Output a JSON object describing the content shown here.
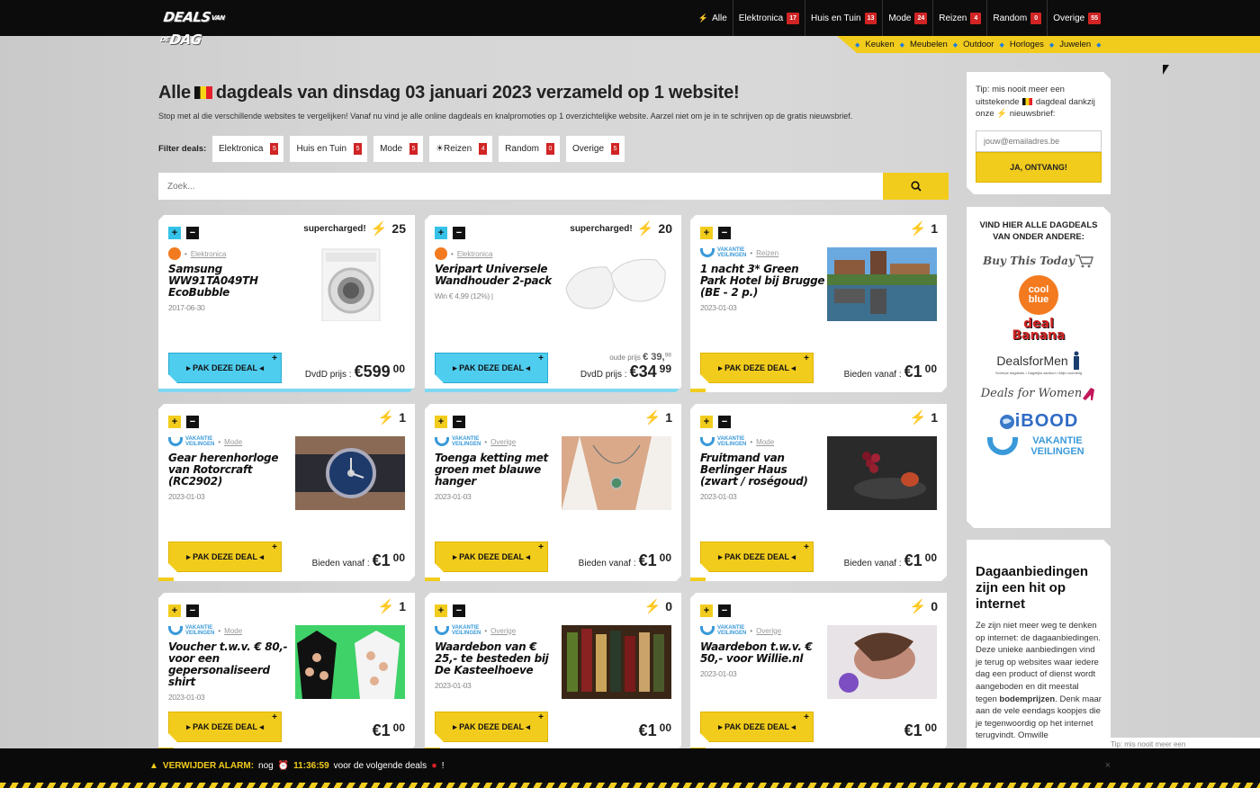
{
  "header": {
    "logo": {
      "part1": "DEALS",
      "small": "VAN DE",
      "part2": "DAG"
    },
    "nav": [
      {
        "label": "Alle",
        "badge": null,
        "icon": "bolt-icon"
      },
      {
        "label": "Elektronica",
        "badge": "17"
      },
      {
        "label": "Huis en Tuin",
        "badge": "13"
      },
      {
        "label": "Mode",
        "badge": "24"
      },
      {
        "label": "Reizen",
        "badge": "4"
      },
      {
        "label": "Random",
        "badge": "0"
      },
      {
        "label": "Overige",
        "badge": "55"
      }
    ],
    "subnav": [
      "Keuken",
      "Meubelen",
      "Outdoor",
      "Horloges",
      "Juwelen"
    ]
  },
  "main": {
    "title_pre": "Alle",
    "title_post": "dagdeals van dinsdag 03 januari 2023 verzameld op 1 website!",
    "intro": "Stop met al die verschillende websites te vergelijken! Vanaf nu vind je alle online dagdeals en knalpromoties op 1 overzichtelijke website. Aarzel niet om je in te schrijven op de gratis nieuwsbrief.",
    "filter_label": "Filter deals:",
    "filters": [
      {
        "label": "Elektronica",
        "badge": "5"
      },
      {
        "label": "Huis en Tuin",
        "badge": "5"
      },
      {
        "label": "Mode",
        "badge": "5"
      },
      {
        "label": "☀Reizen",
        "badge": "4"
      },
      {
        "label": "Random",
        "badge": "0"
      },
      {
        "label": "Overige",
        "badge": "5"
      }
    ],
    "search_placeholder": "Zoek..."
  },
  "deals": [
    {
      "supercharged": "supercharged!",
      "count": "25",
      "source": "coolblue",
      "category": "Elektronica",
      "title": "Samsung WW91TA049TH EcoBubble",
      "meta": "2017-06-30",
      "button": "▸ PAK DEZE DEAL ◂",
      "price_label": "DvdD prijs :",
      "price_main": "€599",
      "price_cents": "00",
      "old_label": "",
      "old_price": "",
      "progress": 1.0,
      "style": "blue"
    },
    {
      "supercharged": "supercharged!",
      "count": "20",
      "source": "coolblue",
      "category": "Elektronica",
      "title": "Veripart Universele Wandhouder 2-pack",
      "meta": "Win € 4,99 (12%) |",
      "button": "▸ PAK DEZE DEAL ◂",
      "price_label": "DvdD prijs :",
      "price_main": "€34",
      "price_cents": "99",
      "old_label": "oude prijs",
      "old_price": "€ 39,",
      "old_cents": "98",
      "progress": 1.0,
      "style": "blue"
    },
    {
      "supercharged": "",
      "count": "1",
      "source": "vakantieveilingen",
      "category": "Reizen",
      "title": "1 nacht 3* Green Park Hotel bij Brugge (BE - 2 p.)",
      "meta": "2023-01-03",
      "button": "▸ PAK DEZE DEAL ◂",
      "price_label": "Bieden vanaf :",
      "price_main": "€1",
      "price_cents": "00",
      "progress": 0.06,
      "style": "yellow"
    },
    {
      "supercharged": "",
      "count": "1",
      "source": "vakantieveilingen",
      "category": "Mode",
      "title": "Gear herenhorloge van Rotorcraft (RC2902)",
      "meta": "2023-01-03",
      "button": "▸ PAK DEZE DEAL ◂",
      "price_label": "Bieden vanaf :",
      "price_main": "€1",
      "price_cents": "00",
      "progress": 0.06,
      "style": "yellow"
    },
    {
      "supercharged": "",
      "count": "1",
      "source": "vakantieveilingen",
      "category": "Overige",
      "title": "Toenga ketting met groen met blauwe hanger",
      "meta": "2023-01-03",
      "button": "▸ PAK DEZE DEAL ◂",
      "price_label": "Bieden vanaf :",
      "price_main": "€1",
      "price_cents": "00",
      "progress": 0.06,
      "style": "yellow"
    },
    {
      "supercharged": "",
      "count": "1",
      "source": "vakantieveilingen",
      "category": "Mode",
      "title": "Fruitmand van Berlinger Haus (zwart / roségoud)",
      "meta": "2023-01-03",
      "button": "▸ PAK DEZE DEAL ◂",
      "price_label": "Bieden vanaf :",
      "price_main": "€1",
      "price_cents": "00",
      "progress": 0.06,
      "style": "yellow"
    },
    {
      "supercharged": "",
      "count": "1",
      "source": "vakantieveilingen",
      "category": "Mode",
      "title": "Voucher t.w.v. € 80,- voor een gepersonaliseerd shirt",
      "meta": "2023-01-03",
      "button": "▸ PAK DEZE DEAL ◂",
      "price_label": "",
      "price_main": "€1",
      "price_cents": "00",
      "progress": 0.06,
      "style": "yellow"
    },
    {
      "supercharged": "",
      "count": "0",
      "source": "vakantieveilingen",
      "category": "Overige",
      "title": "Waardebon van € 25,- te besteden bij De Kasteelhoeve",
      "meta": "2023-01-03",
      "button": "▸ PAK DEZE DEAL ◂",
      "price_label": "",
      "price_main": "€1",
      "price_cents": "00",
      "progress": 0.06,
      "style": "yellow"
    },
    {
      "supercharged": "",
      "count": "0",
      "source": "vakantieveilingen",
      "category": "Overige",
      "title": "Waardebon t.w.v. € 50,- voor Willie.nl",
      "meta": "2023-01-03",
      "button": "▸ PAK DEZE DEAL ◂",
      "price_label": "",
      "price_main": "€1",
      "price_cents": "00",
      "progress": 0.06,
      "style": "yellow"
    }
  ],
  "sidebar": {
    "tip": "Tip: mis nooit meer een uitstekende",
    "tip2": "dagdeal dankzij onze",
    "tip3": "nieuwsbrief:",
    "email_placeholder": "jouw@emailadres.be",
    "submit": "JA, ONTVANG!",
    "partners_title": "VIND HIER ALLE DAGDEALS VAN ONDER ANDERE:",
    "partners": [
      "Buy This Today",
      "cool blue",
      "deal Banana",
      "DealsforMen",
      "Deals for Women",
      "iBOOD",
      "VAKANTIE VEILINGEN"
    ],
    "dealsformen_tag": "Scherpe dagdeals • Dagelijks aanbod • Altijd voordelig",
    "info_title": "Dagaanbiedingen zijn een hit op internet",
    "info_text": "Ze zijn niet meer weg te denken op internet: de dagaanbiedingen. Deze unieke aanbiedingen vind je terug op websites waar iedere dag een product of dienst wordt aangeboden en dit meestal tegen",
    "info_bold": "bodemprijzen",
    "info_text2": ". Denk maar aan de vele eendags koopjes die je tegenwoordig op het internet terugvindt. Omwille"
  },
  "footer": {
    "alarm_label": "VERWIJDER ALARM:",
    "pre": "nog",
    "time": "11:36:59",
    "post": "voor de volgende deals",
    "excl": "!",
    "tip_float": "Tip: mis nooit meer een",
    "close": "×"
  },
  "colors": {
    "accent": "#f2cc1d",
    "blue": "#35c2e8",
    "badge": "#d12424",
    "dark": "#0c0c0c"
  }
}
